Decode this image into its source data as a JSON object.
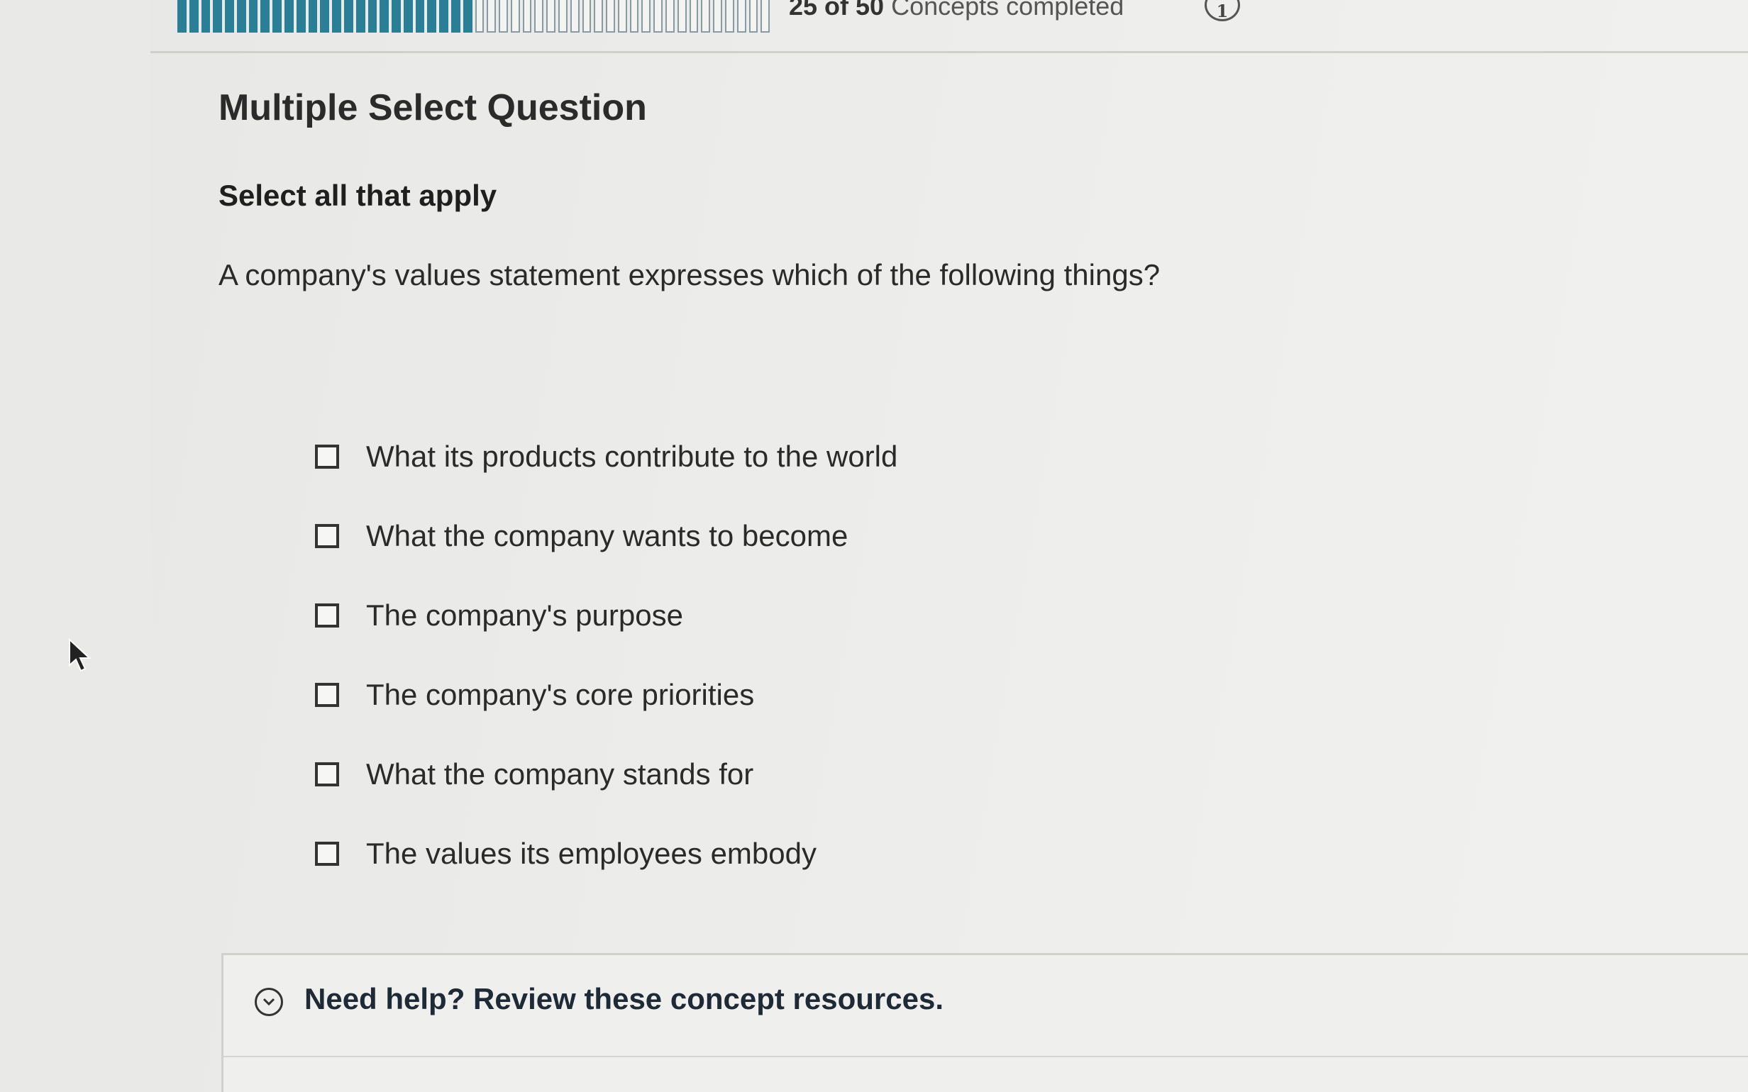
{
  "progress": {
    "completed": 25,
    "total": 50,
    "count_text": "25 of 50",
    "suffix_text": "Concepts completed",
    "badge": "1",
    "segments_done": 25,
    "segments_total": 50,
    "accent_color": "#2a7f97"
  },
  "question": {
    "type_title": "Multiple Select Question",
    "instruction": "Select all that apply",
    "prompt": "A company's values statement expresses which of the following things?",
    "options": [
      {
        "label": "What its products contribute to the world",
        "checked": false
      },
      {
        "label": "What the company wants to become",
        "checked": false
      },
      {
        "label": "The company's purpose",
        "checked": false
      },
      {
        "label": "The company's core priorities",
        "checked": false
      },
      {
        "label": "What the company stands for",
        "checked": false
      },
      {
        "label": "The values its employees embody",
        "checked": false
      }
    ]
  },
  "help": {
    "icon": "chevron-down-circle-icon",
    "text": "Need help? Review these concept resources."
  }
}
